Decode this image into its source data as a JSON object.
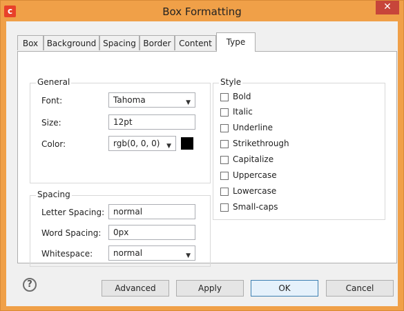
{
  "window": {
    "app_icon_letter": "c",
    "title": "Box Formatting",
    "close_glyph": "✕"
  },
  "tabs": [
    {
      "label": "Box"
    },
    {
      "label": "Background"
    },
    {
      "label": "Spacing"
    },
    {
      "label": "Border"
    },
    {
      "label": "Content"
    },
    {
      "label": "Type",
      "active": true
    }
  ],
  "general": {
    "legend": "General",
    "font_label": "Font:",
    "font_value": "Tahoma",
    "size_label": "Size:",
    "size_value": "12pt",
    "color_label": "Color:",
    "color_value": "rgb(0, 0, 0)",
    "color_swatch": "#000000"
  },
  "spacing": {
    "legend": "Spacing",
    "letter_label": "Letter Spacing:",
    "letter_value": "normal",
    "word_label": "Word Spacing:",
    "word_value": "0px",
    "whitespace_label": "Whitespace:",
    "whitespace_value": "normal"
  },
  "style": {
    "legend": "Style",
    "options": [
      {
        "label": "Bold",
        "checked": false
      },
      {
        "label": "Italic",
        "checked": false
      },
      {
        "label": "Underline",
        "checked": false
      },
      {
        "label": "Strikethrough",
        "checked": false
      },
      {
        "label": "Capitalize",
        "checked": false
      },
      {
        "label": "Uppercase",
        "checked": false
      },
      {
        "label": "Lowercase",
        "checked": false
      },
      {
        "label": "Small-caps",
        "checked": false
      }
    ]
  },
  "footer": {
    "help_glyph": "?",
    "advanced_label": "Advanced",
    "apply_label": "Apply",
    "ok_label": "OK",
    "cancel_label": "Cancel"
  },
  "colors": {
    "title_bar": "#f0a048",
    "app_icon": "#e8402a",
    "close_button": "#c7453a",
    "ok_border": "#3c7fb1"
  }
}
